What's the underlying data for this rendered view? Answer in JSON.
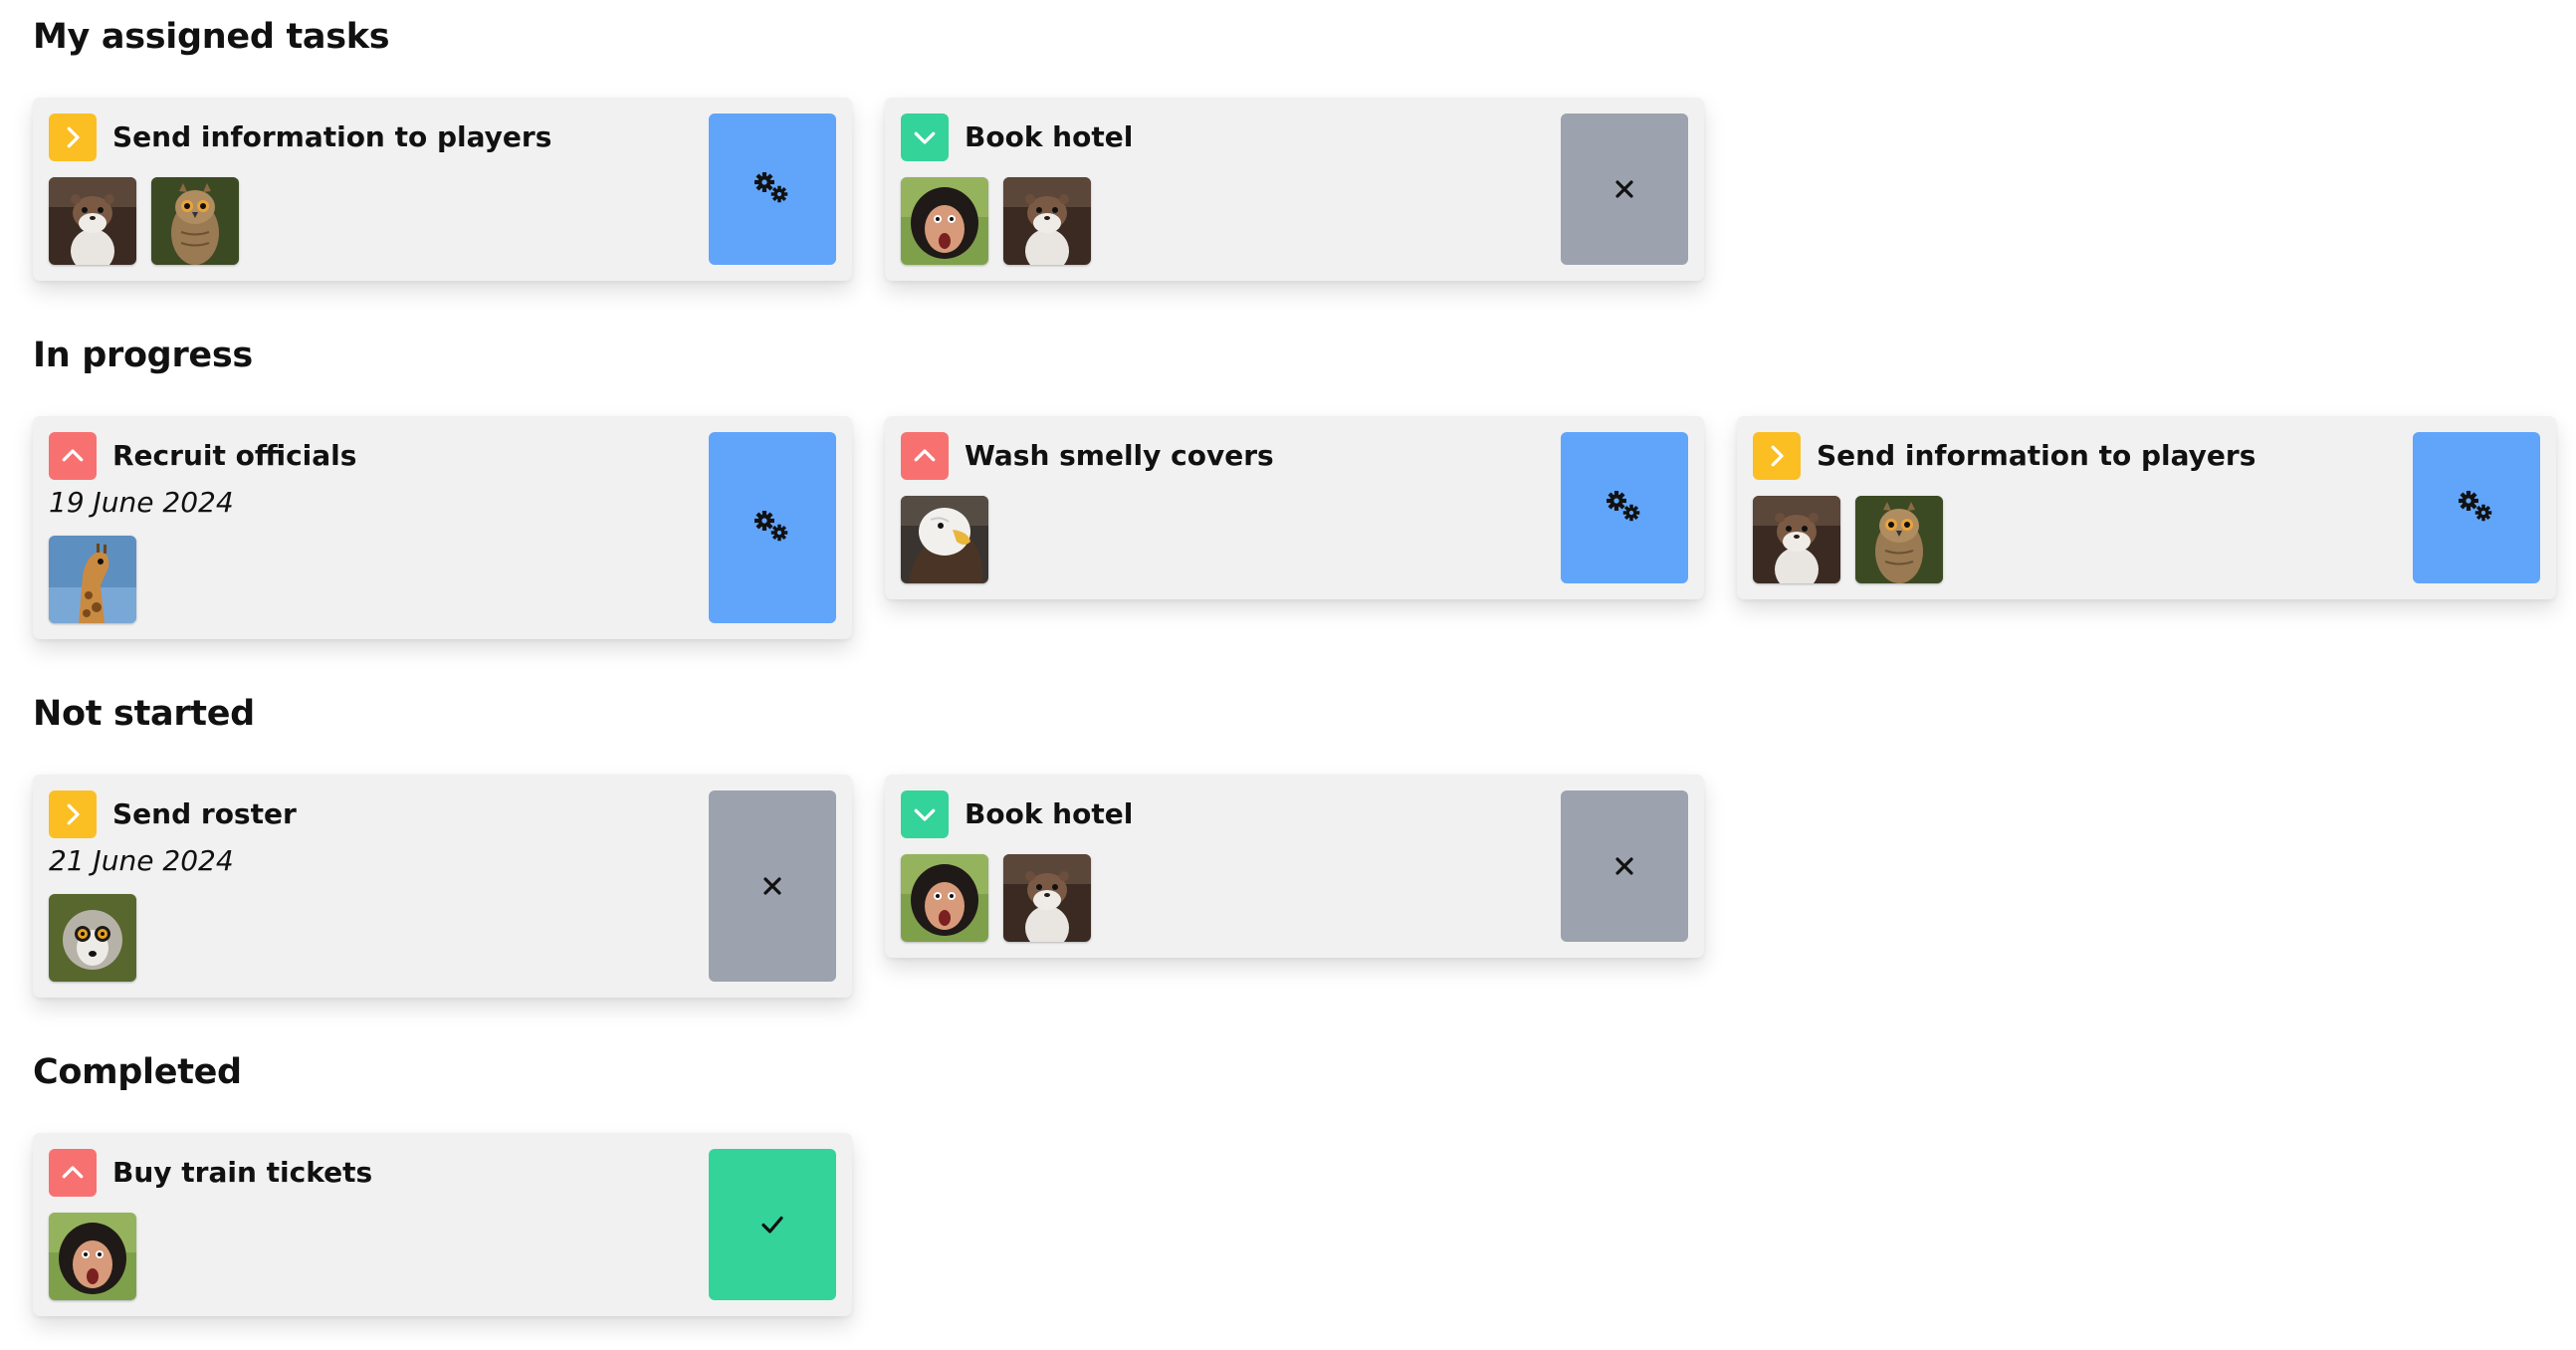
{
  "sections": [
    {
      "title": "My assigned tasks",
      "cards": [
        {
          "title": "Send information to players",
          "priority": "medium",
          "priority_icon": "chevron-right-icon",
          "date": "",
          "avatars": [
            "stoat",
            "owl"
          ],
          "action": "in-progress",
          "action_icon": "gears-icon"
        },
        {
          "title": "Book hotel",
          "priority": "low",
          "priority_icon": "chevron-down-icon",
          "date": "",
          "avatars": [
            "monkey",
            "stoat"
          ],
          "action": "cancel",
          "action_icon": "close-icon"
        }
      ]
    },
    {
      "title": "In progress",
      "cards": [
        {
          "title": "Recruit officials",
          "priority": "high",
          "priority_icon": "chevron-up-icon",
          "date": "19 June 2024",
          "avatars": [
            "giraffe"
          ],
          "action": "in-progress",
          "action_icon": "gears-icon"
        },
        {
          "title": "Wash smelly covers",
          "priority": "high",
          "priority_icon": "chevron-up-icon",
          "date": "",
          "avatars": [
            "eagle"
          ],
          "action": "in-progress",
          "action_icon": "gears-icon"
        },
        {
          "title": "Send information to players",
          "priority": "medium",
          "priority_icon": "chevron-right-icon",
          "date": "",
          "avatars": [
            "stoat",
            "owl"
          ],
          "action": "in-progress",
          "action_icon": "gears-icon"
        }
      ]
    },
    {
      "title": "Not started",
      "cards": [
        {
          "title": "Send roster",
          "priority": "medium",
          "priority_icon": "chevron-right-icon",
          "date": "21 June 2024",
          "avatars": [
            "lemur"
          ],
          "action": "cancel",
          "action_icon": "close-icon"
        },
        {
          "title": "Book hotel",
          "priority": "low",
          "priority_icon": "chevron-down-icon",
          "date": "",
          "avatars": [
            "monkey",
            "stoat"
          ],
          "action": "cancel",
          "action_icon": "close-icon"
        }
      ]
    },
    {
      "title": "Completed",
      "cards": [
        {
          "title": "Buy train tickets",
          "priority": "high",
          "priority_icon": "chevron-up-icon",
          "date": "",
          "avatars": [
            "monkey"
          ],
          "action": "done",
          "action_icon": "checkmark-icon"
        }
      ]
    }
  ],
  "colors": {
    "priority_high": "#f87171",
    "priority_medium": "#fbbf24",
    "priority_low": "#34d399",
    "action_in_progress": "#60a5fa",
    "action_cancel": "#9ca3af",
    "action_done": "#34d399",
    "card_bg": "#f1f1f1"
  }
}
